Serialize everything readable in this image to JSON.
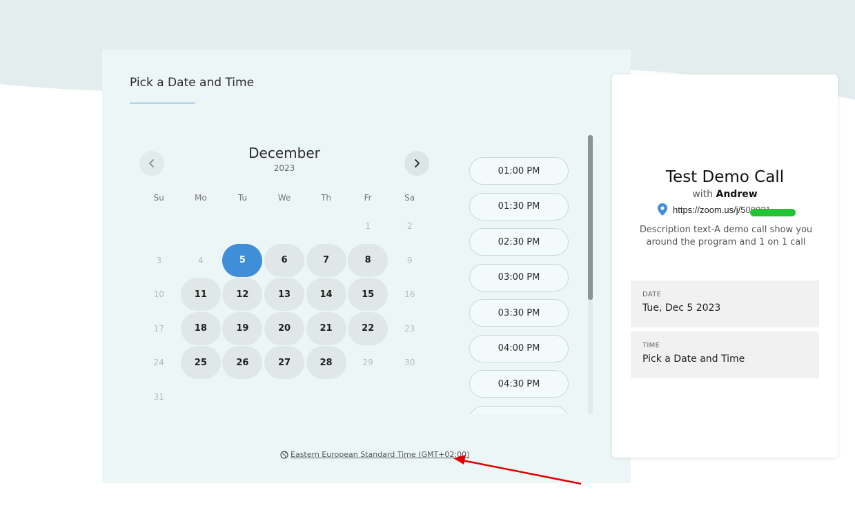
{
  "colors": {
    "accent": "#3e8ed8",
    "panel_bg": "#edf6f7",
    "wave_bg": "#e3edee",
    "available_day_bg": "#e0e7e7",
    "annotation_arrow": "#e00000",
    "redaction": "#22c334"
  },
  "scheduler": {
    "heading": "Pick a Date and Time",
    "calendar": {
      "month": "December",
      "year": "2023",
      "prev_icon": "chevron-left-icon",
      "next_icon": "chevron-right-icon",
      "weekdays": [
        "Su",
        "Mo",
        "Tu",
        "We",
        "Th",
        "Fr",
        "Sa"
      ],
      "first_weekday_index": 5,
      "days_in_month": 31,
      "selected_day": 5,
      "available_days": [
        5,
        6,
        7,
        8,
        11,
        12,
        13,
        14,
        15,
        18,
        19,
        20,
        21,
        22,
        25,
        26,
        27,
        28
      ]
    },
    "time_slots": [
      "01:00 PM",
      "01:30 PM",
      "02:30 PM",
      "03:00 PM",
      "03:30 PM",
      "04:00 PM",
      "04:30 PM",
      ""
    ],
    "scroll_fraction_visible": 0.59,
    "timezone": {
      "icon": "globe-icon",
      "label": "Eastern European Standard Time (GMT+02:00)"
    }
  },
  "event": {
    "title": "Test Demo Call",
    "host_prefix": "with",
    "host_name": "Andrew",
    "location_icon": "map-pin-icon",
    "location_text": "https://zoom.us/j/5",
    "location_text_trailing": "00021",
    "description": "Description text-A demo call show you around the program and 1 on 1 call",
    "date_label": "DATE",
    "date_value": "Tue, Dec 5 2023",
    "time_label": "TIME",
    "time_value": "Pick a Date and Time"
  }
}
